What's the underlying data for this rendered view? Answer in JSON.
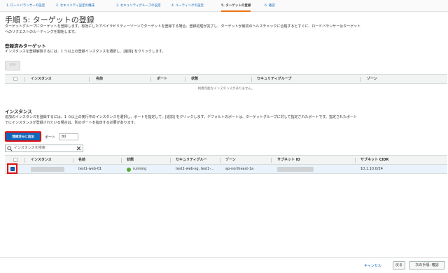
{
  "wizard": {
    "tabs": [
      "1. ロードバランサーの設定",
      "2. セキュリティ設定の構成",
      "3. セキュリティグループの設定",
      "4. ルーティングの設定",
      "5. ターゲットの登録",
      "6. 確認"
    ],
    "active_index": 4
  },
  "page": {
    "title": "手順 5: ターゲットの登録",
    "description_line1": "ターゲットグループにターゲットを登録します。有効にしたアベイラビリティーゾーンでターゲットを登録する場合、登録処理が完了し、ターゲットが最初のヘルスチェックに合格するとすぐに、ロードバランサーはターゲット",
    "description_line2": "へのリクエストのルーティングを開始します。"
  },
  "registered": {
    "title": "登録済みターゲット",
    "description": "インスタンスを登録解除するには、1 つ以上の登録インスタンスを選択し、[削除] をクリックします。",
    "remove_button": "削除",
    "columns": [
      "インスタンス",
      "名前",
      "ポート",
      "状態",
      "セキュリティグループ",
      "ゾーン"
    ],
    "empty_message": "利用可能なインスタンスがありません。"
  },
  "instances": {
    "title": "インスタンス",
    "description_line1": "追加のインスタンスを登録するには、1 つ以上の実行中のインスタンスを選択し、ポートを指定して、[追加] をクリックします。デフォルトのポートは、ターゲットグループに対して指定されたポートです。指定されたポート",
    "description_line2": "でにインスタンスが登録されている場合は、別のポートを指定する必要があります。",
    "add_button": "登録済みに追加",
    "port_label": "ポート",
    "port_value": "80",
    "search_placeholder": "インスタンスを検索",
    "columns": [
      "インスタンス",
      "名前",
      "状態",
      "セキュリティグルー",
      "ゾーン",
      "サブネット ID",
      "サブネット CIDR"
    ],
    "rows": [
      {
        "name": "test1-web-01",
        "state": "running",
        "security_group": "test1-web-sg, test1-...",
        "zone": "ap-northeast-1a",
        "subnet_cidr": "10.1.10.0/24",
        "selected": true
      }
    ]
  },
  "footer": {
    "cancel": "キャンセル",
    "back": "戻る",
    "next": "次の手順: 確認"
  },
  "colors": {
    "accent": "#1166bb",
    "active_tab_underline": "#ec7211",
    "highlight": "#e01010",
    "running": "#5aa832"
  }
}
